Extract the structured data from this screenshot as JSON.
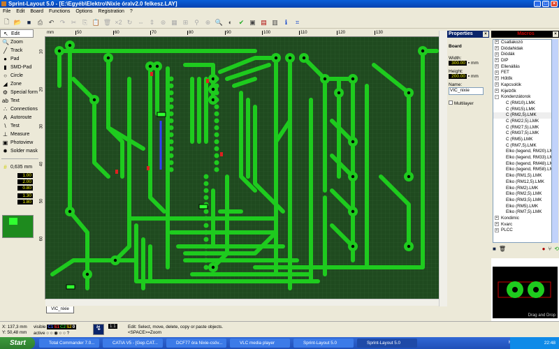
{
  "window": {
    "title": "Sprint-Layout 5.0 - [E:\\Egyéb\\Elektro\\Nixie óra\\v2.0 felkesz.LAY]"
  },
  "menu": [
    "File",
    "Edit",
    "Board",
    "Functions",
    "Options",
    "Registration",
    "?"
  ],
  "tools": [
    {
      "label": "Edit",
      "icon": "cursor-icon",
      "glyph": "↖"
    },
    {
      "label": "Zoom",
      "icon": "zoom-icon",
      "glyph": "🔍"
    },
    {
      "label": "Track",
      "icon": "track-icon",
      "glyph": "╱"
    },
    {
      "label": "Pad",
      "icon": "pad-icon",
      "glyph": "●"
    },
    {
      "label": "SMD-Pad",
      "icon": "smd-pad-icon",
      "glyph": "▮"
    },
    {
      "label": "Circle",
      "icon": "circle-icon",
      "glyph": "○"
    },
    {
      "label": "Zone",
      "icon": "zone-icon",
      "glyph": "◢"
    },
    {
      "label": "Special form",
      "icon": "special-form-icon",
      "glyph": "⚙"
    },
    {
      "label": "Text",
      "icon": "text-icon",
      "glyph": "ab"
    },
    {
      "label": "Connections",
      "icon": "connections-icon",
      "glyph": "∴"
    },
    {
      "label": "Autoroute",
      "icon": "autoroute-icon",
      "glyph": "A"
    },
    {
      "label": "Test",
      "icon": "test-icon",
      "glyph": "\\"
    },
    {
      "label": "Measure",
      "icon": "measure-icon",
      "glyph": "⊥"
    },
    {
      "label": "Photoview",
      "icon": "photoview-icon",
      "glyph": "▣"
    },
    {
      "label": "Solder mask",
      "icon": "solder-mask-icon",
      "glyph": "✹"
    }
  ],
  "grid": "0,635 mm",
  "track_width": "1.00",
  "pad_outer": "2.00",
  "pad_inner": "0.80",
  "smd_w": "1.30",
  "smd_h": "1.80",
  "ruler_top": [
    "mm",
    "50",
    "60",
    "70",
    "80",
    "90",
    "100",
    "110",
    "120",
    "130"
  ],
  "ruler_left": [
    "10",
    "20",
    "30",
    "40",
    "50",
    "60"
  ],
  "board_tab": "VIC_nixie",
  "properties": {
    "title": "Properties",
    "section": "Board",
    "width_label": "Width:",
    "width": "300.00",
    "height_label": "Height:",
    "height": "200.00",
    "unit": "mm",
    "name_label": "Name:",
    "name": "VIC_nixie",
    "multilayer": "Multilayer"
  },
  "macros": {
    "title": "Macros",
    "items": [
      {
        "t": "Csatlakozó",
        "g": "+"
      },
      {
        "t": "Diódahidak",
        "g": "+"
      },
      {
        "t": "Diódák",
        "g": "+"
      },
      {
        "t": "DIP",
        "g": "+"
      },
      {
        "t": "Ellenállás",
        "g": "+"
      },
      {
        "t": "FET",
        "g": "+"
      },
      {
        "t": "Hűtők",
        "g": "+"
      },
      {
        "t": "Kapcsolók",
        "g": "+"
      },
      {
        "t": "Kijelzők",
        "g": "+"
      },
      {
        "t": "Kondenzátorok",
        "g": "-"
      },
      {
        "t": "C (RM10).LMK"
      },
      {
        "t": "C (RM15).LMK"
      },
      {
        "t": "C (RM2,5).LMK"
      },
      {
        "t": "C (RM22,5).LMK"
      },
      {
        "t": "C (RM27,5).LMK"
      },
      {
        "t": "C (RM37,5).LMK"
      },
      {
        "t": "C (RM5).LMK"
      },
      {
        "t": "C (RM7,5).LMK"
      },
      {
        "t": "Elko (legend, RM20).LMK"
      },
      {
        "t": "Elko (legend, RM33).LMK"
      },
      {
        "t": "Elko (legend, RM48).LMK"
      },
      {
        "t": "Elko (legend, RM58).LMK"
      },
      {
        "t": "Elko (RM1,5).LMK"
      },
      {
        "t": "Elko (RM12,5).LMK"
      },
      {
        "t": "Elko (RM2).LMK"
      },
      {
        "t": "Elko (RM2,5).LMK"
      },
      {
        "t": "Elko (RM3,5).LMK"
      },
      {
        "t": "Elko (RM5).LMK"
      },
      {
        "t": "Elko (RM7,5).LMK"
      },
      {
        "t": "Kondimic",
        "g": "+"
      },
      {
        "t": "Kvarc",
        "g": "+"
      },
      {
        "t": "PLCC",
        "g": "+"
      }
    ],
    "preview_caption": "Drag and Drop"
  },
  "status": {
    "x": "X:  137,3 mm",
    "y": "Y:  50,48 mm",
    "visible": "visible",
    "active": "active",
    "layers": [
      "C1",
      "S1",
      "C2",
      "S2",
      "0"
    ],
    "layer_colors": [
      "#4060ff",
      "#ff3030",
      "#30c030",
      "#e0c000",
      "#ffffff"
    ],
    "zoom_level": "1:1",
    "hint1": "Edit: Select, move, delete, copy or paste objects.",
    "hint2": "<SPACE>=Zoom",
    "help": "?"
  },
  "taskbar": {
    "start": "Start",
    "tasks": [
      "Total Commander 7.0...",
      "CATIA V5 - [Gep.CAT...",
      "DCF77 óra Nixie-csöv...",
      "VLC media player",
      "Sprint-Layout 5.0",
      "Sprint-Layout 5.0"
    ],
    "lang": "HU",
    "time": "22:48"
  },
  "colors": {
    "track": "#1ecb1e",
    "board": "#1f4a1f"
  }
}
